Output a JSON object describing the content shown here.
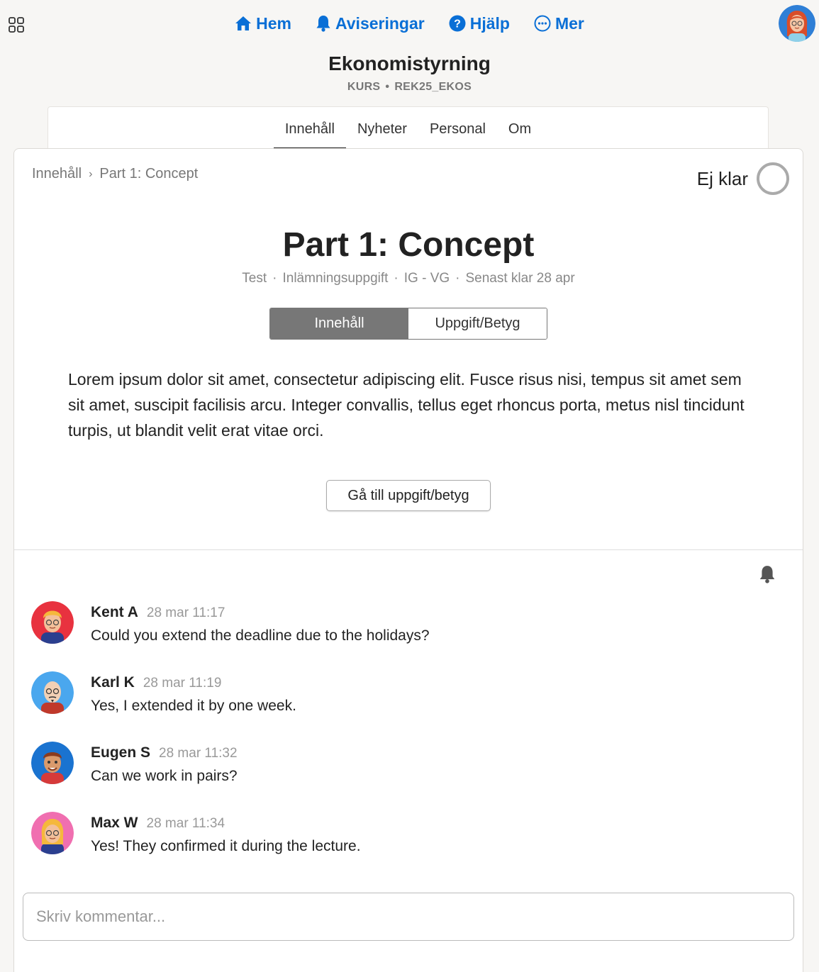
{
  "topnav": {
    "items": [
      {
        "label": "Hem",
        "icon": "home-icon"
      },
      {
        "label": "Aviseringar",
        "icon": "bell-icon"
      },
      {
        "label": "Hjälp",
        "icon": "help-icon"
      },
      {
        "label": "Mer",
        "icon": "more-icon"
      }
    ],
    "accent": "#0a6fd6"
  },
  "course": {
    "title": "Ekonomistyrning",
    "type": "KURS",
    "separator": "•",
    "code": "REK25_EKOS"
  },
  "tabs": [
    "Innehåll",
    "Nyheter",
    "Personal",
    "Om"
  ],
  "breadcrumb": {
    "root": "Innehåll",
    "separator": "›",
    "current": "Part 1: Concept"
  },
  "status": {
    "label": "Ej klar"
  },
  "page": {
    "title": "Part 1: Concept",
    "meta": [
      "Test",
      "Inlämningsuppgift",
      "IG - VG",
      "Senast klar 28 apr"
    ],
    "meta_separator": "·"
  },
  "segment": {
    "content": "Innehåll",
    "assignment": "Uppgift/Betyg"
  },
  "body_text": "Lorem ipsum dolor sit amet, consectetur adipiscing elit. Fusce risus nisi, tempus sit amet sem sit amet, suscipit facilisis arcu. Integer convallis, tellus eget rhoncus porta, metus nisl tincidunt turpis, ut blandit velit erat vitae orci.",
  "goto_button": "Gå till uppgift/betyg",
  "comments": [
    {
      "name": "Kent A",
      "time": "28 mar 11:17",
      "text": "Could you extend the deadline due to the holidays?",
      "avatar_bg": "#e8323f"
    },
    {
      "name": "Karl K",
      "time": "28 mar 11:19",
      "text": "Yes, I extended it by one week.",
      "avatar_bg": "#4aa7ee"
    },
    {
      "name": "Eugen S",
      "time": "28 mar 11:32",
      "text": "Can we work in pairs?",
      "avatar_bg": "#1a73d0"
    },
    {
      "name": "Max W",
      "time": "28 mar 11:34",
      "text": "Yes! They confirmed it during the lecture.",
      "avatar_bg": "#f06fb0"
    }
  ],
  "comment_input": {
    "placeholder": "Skriv kommentar..."
  }
}
